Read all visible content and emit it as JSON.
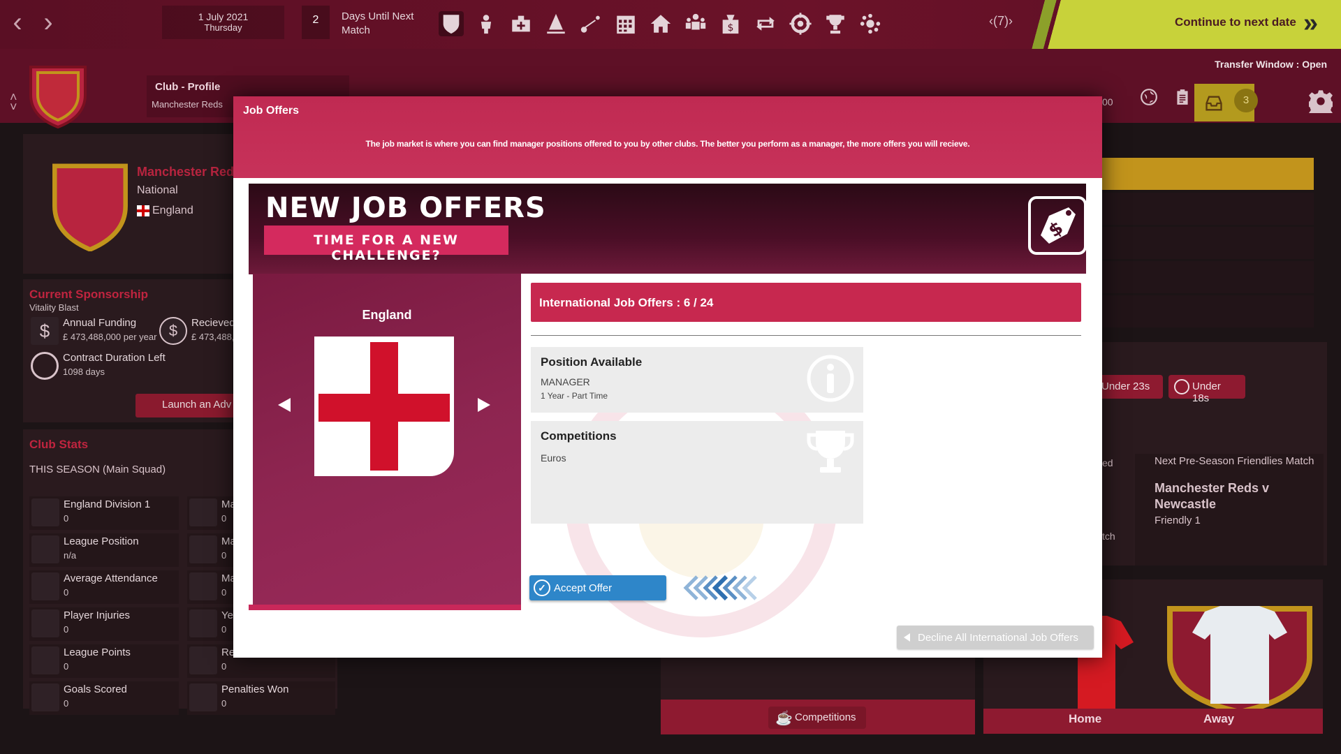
{
  "topbar": {
    "date": "1 July 2021",
    "weekday": "Thursday",
    "days_until_match": "2",
    "days_label_1": "Days Until Next",
    "days_label_2": "Match",
    "speed": "7",
    "continue_label": "Continue to next date",
    "icons": [
      "shield-icon",
      "players-icon",
      "medical-icon",
      "training-icon",
      "tactics-icon",
      "calendar-icon",
      "stadium-icon",
      "staff-icon",
      "finance-icon",
      "transfers-icon",
      "scouting-icon",
      "trophy-icon",
      "board-icon"
    ]
  },
  "subbar": {
    "transfer_window_label": "Transfer Window :",
    "transfer_window_status": "Open",
    "club_profile_title": "Club - Profile",
    "club_profile_sub": "Manchester Reds",
    "money_partial": "00",
    "inbox_count": "3"
  },
  "left_panel": {
    "club_name": "Manchester Reds",
    "club_type": "National",
    "country": "England",
    "sponsorship_title": "Current Sponsorship",
    "sponsor_name": "Vitality Blast",
    "annual_funding_label": "Annual Funding",
    "annual_funding_value": "£ 473,488,000 per year",
    "received_label": "Recieved",
    "received_value": "£ 473,488,0",
    "contract_label": "Contract Duration Left",
    "contract_value": "1098 days",
    "launch_label": "Launch an Adv",
    "club_stats_title": "Club Stats",
    "season_label": "THIS SEASON (Main Squad)",
    "stats": [
      {
        "label": "England Division 1",
        "value": "0"
      },
      {
        "label": "League Position",
        "value": "n/a"
      },
      {
        "label": "Average Attendance",
        "value": "0"
      },
      {
        "label": "Player Injuries",
        "value": "0"
      },
      {
        "label": "League Points",
        "value": "0"
      },
      {
        "label": "Goals Scored",
        "value": "0"
      }
    ],
    "stats2": [
      {
        "label": "Ma",
        "value": "0"
      },
      {
        "label": "Ma",
        "value": "0"
      },
      {
        "label": "Ma",
        "value": "0"
      },
      {
        "label": "Yel",
        "value": "0"
      },
      {
        "label": "Re",
        "value": "0"
      },
      {
        "label": "Penalties Won",
        "value": "0"
      }
    ]
  },
  "right_panel": {
    "under23": "Under 23s",
    "under18": "Under 18s",
    "partial_ed": "ed",
    "partial_tch": "tch",
    "next_title": "Next Pre-Season Friendlies Match",
    "next_match": "Manchester Reds v Newcastle",
    "next_type": "Friendly 1",
    "home_label": "Home",
    "away_label": "Away",
    "competitions_label": "Competitions"
  },
  "modal": {
    "title": "Job Offers",
    "description": "The job market is where you can find manager positions offered to you by other clubs. The better you perform as a manager, the more offers you will recieve.",
    "banner_title": "NEW JOB OFFERS",
    "banner_sub": "TIME FOR A NEW CHALLENGE?",
    "country": "England",
    "offers_label": "International Job Offers :  6 / 24",
    "position_title": "Position Available",
    "position_role": "MANAGER",
    "position_term": "1 Year - Part Time",
    "competitions_title": "Competitions",
    "competitions_value": "Euros",
    "accept_label": "Accept Offer",
    "decline_label": "Decline All International Job Offers",
    "colors": {
      "header": "#c7284f",
      "accept": "#2e86c9",
      "flag_red": "#d0112b"
    }
  }
}
